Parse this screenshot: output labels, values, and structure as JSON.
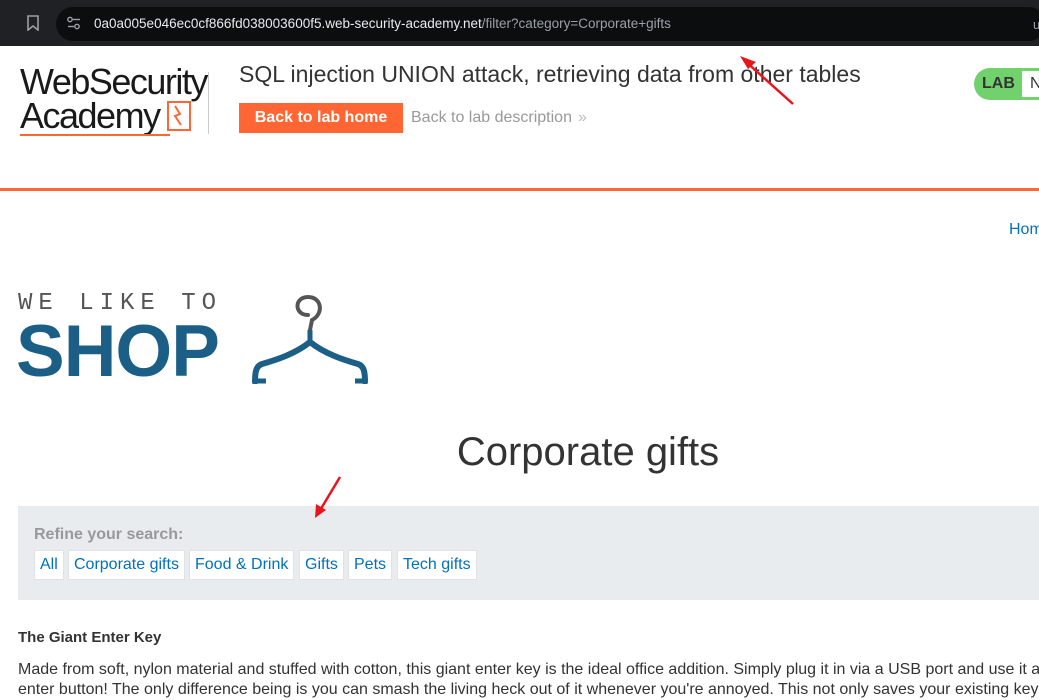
{
  "browser": {
    "url_host": "0a0a005e046ec0cf866fd038003600f5.web-security-academy.net",
    "url_path": "/filter?category=Corporate+gifts",
    "edge_char": "u"
  },
  "lab_header": {
    "logo_line1": "WebSecurity",
    "logo_line2": "Academy",
    "title": "SQL injection UNION attack, retrieving data from other tables",
    "back_home": "Back to lab home",
    "back_description": "Back to lab description",
    "badge_label": "LAB",
    "badge_status": "N"
  },
  "nav": {
    "home_link": "Hom"
  },
  "shop_logo": {
    "tagline": "WE LIKE TO",
    "word": "SHOP"
  },
  "page": {
    "category_title": "Corporate gifts"
  },
  "filters": {
    "label": "Refine your search:",
    "items": [
      "All",
      "Corporate gifts",
      "Food & Drink",
      "Gifts",
      "Pets",
      "Tech gifts"
    ]
  },
  "product": {
    "name": "The Giant Enter Key",
    "description_line1": "Made from soft, nylon material and stuffed with cotton, this giant enter key is the ideal office addition. Simply plug it in via a USB port and use it a",
    "description_line2": "enter button! The only difference being is you can smash the living heck out of it whenever you're annoyed. This not only saves your existing key"
  },
  "colors": {
    "accent": "#ff6633",
    "link": "#0071bc",
    "shop_blue": "#1b5f86",
    "annotation": "#e8151b"
  }
}
